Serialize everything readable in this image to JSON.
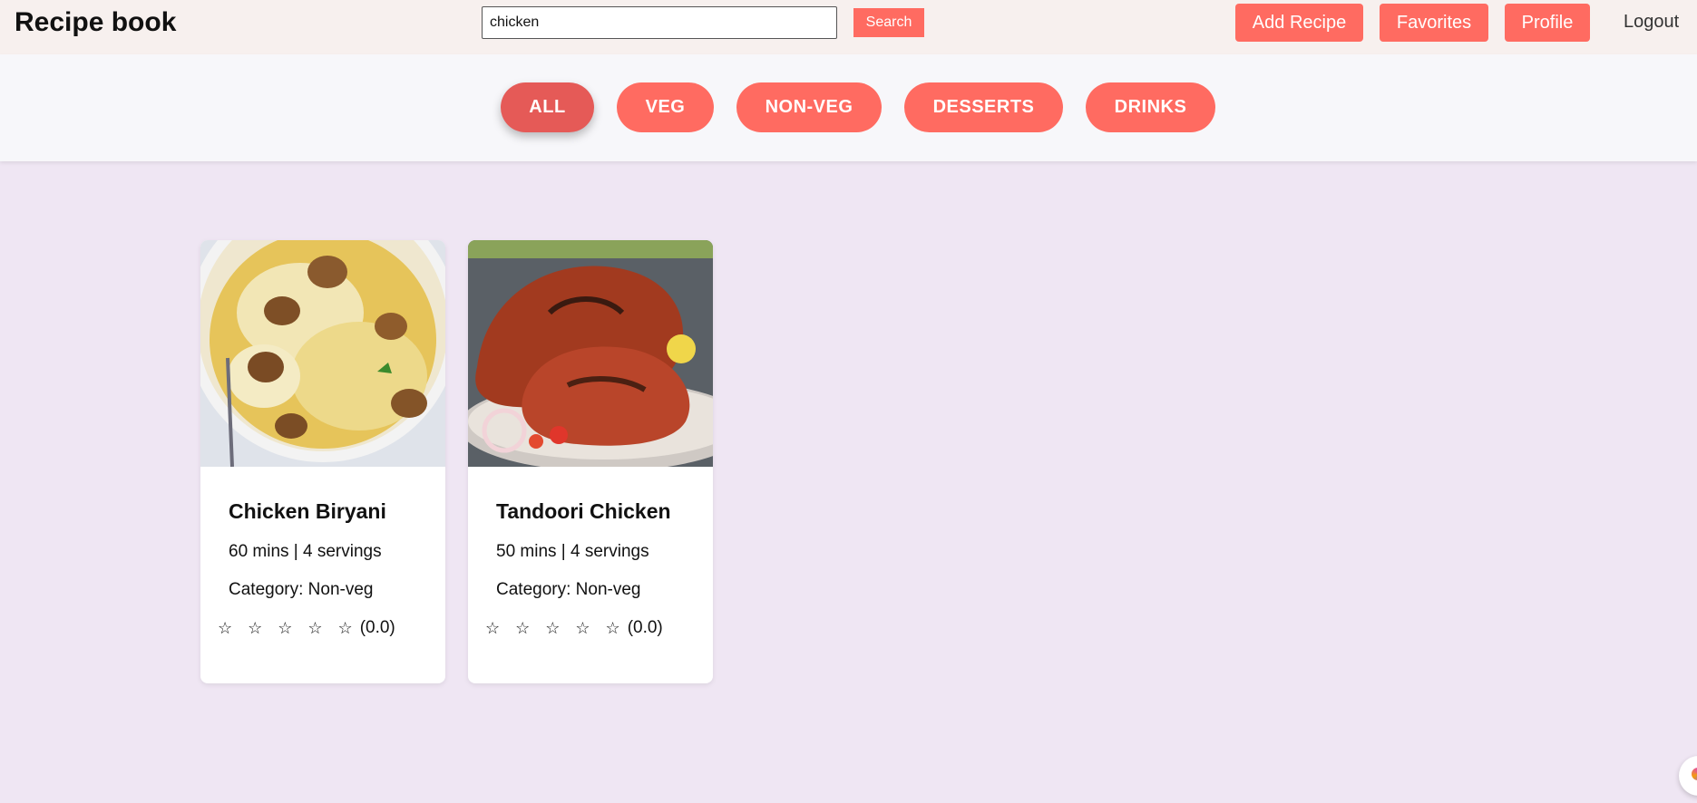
{
  "header": {
    "brand": "Recipe book",
    "search": {
      "value": "chicken",
      "button_label": "Search"
    },
    "nav": {
      "add_recipe": "Add Recipe",
      "favorites": "Favorites",
      "profile": "Profile",
      "logout": "Logout"
    }
  },
  "filters": {
    "items": [
      {
        "label": "ALL",
        "active": true
      },
      {
        "label": "VEG",
        "active": false
      },
      {
        "label": "NON-VEG",
        "active": false
      },
      {
        "label": "DESSERTS",
        "active": false
      },
      {
        "label": "DRINKS",
        "active": false
      }
    ]
  },
  "recipes": [
    {
      "title": "Chicken Biryani",
      "meta": "60 mins | 4 servings",
      "category": "Category: Non-veg",
      "stars": "☆ ☆ ☆ ☆ ☆",
      "rating": "(0.0)",
      "rating_value": 0.0
    },
    {
      "title": "Tandoori Chicken",
      "meta": "50 mins | 4 servings",
      "category": "Category: Non-veg",
      "stars": "☆ ☆ ☆ ☆ ☆",
      "rating": "(0.0)",
      "rating_value": 0.0
    }
  ],
  "colors": {
    "accent": "#ff6b61",
    "accent_active": "#e55a57",
    "page_bg": "#efe6f3",
    "header_bg": "#f7f0ee",
    "filterbar_bg": "#f7f7fa"
  }
}
